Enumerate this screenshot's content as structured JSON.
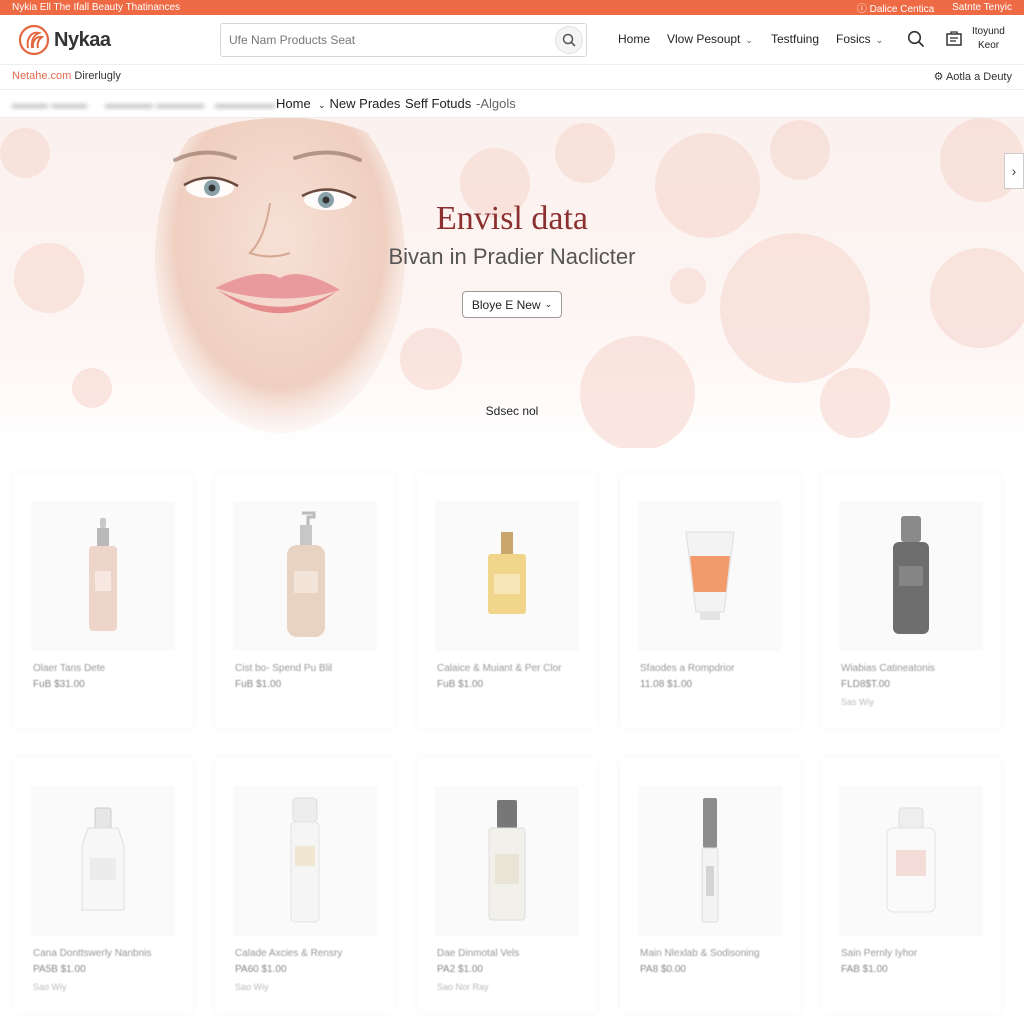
{
  "topbar": {
    "promo": "Nykia Ell The Ifall Beauty Thatinances",
    "link1": "Dalice Centica",
    "link2": "Satnte Tenyic"
  },
  "header": {
    "brand": "Nykaa",
    "search_placeholder": "Ufe Nam Products Seat",
    "nav": [
      "Home",
      "Vlow Pesoupt",
      "Testfuing",
      "Fosics"
    ],
    "account_line1": "Itoyund",
    "account_line2": "Keor"
  },
  "crumbs": {
    "left_brand": "Netahe.com",
    "left_rest": " Direrlugly",
    "right": "Aotla a Deuty"
  },
  "categories": [
    "Home",
    "New Prades",
    "Seff Fotuds",
    "-Algols"
  ],
  "hero": {
    "title": "Envisl data",
    "subtitle": "Bivan in Pradier Naclicter",
    "button": "Bloye E New",
    "select_label": "Sdsec nol"
  },
  "products": [
    {
      "name": "Olaer Tans Dete",
      "price": "FuB $31.00",
      "tag": ""
    },
    {
      "name": "Cist bo- Spend Pu Blil",
      "price": "FuB $1.00",
      "tag": ""
    },
    {
      "name": "Calaice & Muiant & Per Clor",
      "price": "FuB $1.00",
      "tag": ""
    },
    {
      "name": "Sfaodes a Rompdrior",
      "price": "11.08 $1.00",
      "tag": ""
    },
    {
      "name": "Wiabias Catineatonis",
      "price": "FLD8$T.00",
      "tag": "Sas Wiy"
    },
    {
      "name": "Cana Donttswerly Nanbnis",
      "price": "PA5B $1.00",
      "tag": "Sao Wiy"
    },
    {
      "name": "Calade Axcies & Rensry",
      "price": "PA60 $1.00",
      "tag": "Sao Wiy"
    },
    {
      "name": "Dae Dinmotal Vels",
      "price": "PA2 $1.00",
      "tag": "Sao Nor  Ray"
    },
    {
      "name": "Main Nlexlab & Sodisoning",
      "price": "PA8 $0.00",
      "tag": ""
    },
    {
      "name": "Sain Pernly Iyhor",
      "price": "FAB $1.00",
      "tag": ""
    }
  ],
  "colors": {
    "accent": "#ee6a45",
    "hero_title": "#8c2f2f"
  }
}
